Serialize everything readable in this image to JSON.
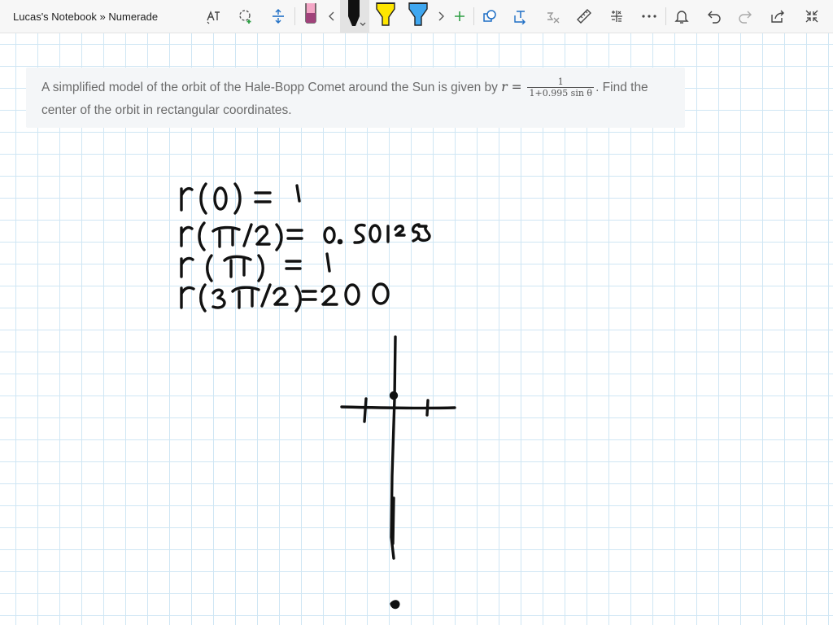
{
  "app": {
    "title": "Lucas's Notebook » Numerade"
  },
  "toolbar": {
    "icons": [
      "lasso-text-icon",
      "lasso-select-icon",
      "insert-space-icon",
      "pen-icon",
      "chevron-left-icon",
      "marker-icon",
      "highlighter-yellow-icon",
      "highlighter-blue-icon",
      "chevron-right-icon",
      "add-pen-icon",
      "ink-to-shape-icon",
      "ink-to-text-icon",
      "ink-to-math-icon",
      "ruler-icon",
      "math-icon",
      "more-icon",
      "bell-icon",
      "undo-icon",
      "redo-icon",
      "share-icon",
      "collapse-icon"
    ],
    "colors": {
      "pen_pink": "#f4a6c6",
      "highlighter_yellow": "#ffe600",
      "highlighter_blue": "#3fa7f0",
      "accent_green": "#2e9e44",
      "accent_blue": "#1f6fc5"
    }
  },
  "question": {
    "text_before": "A simplified model of the orbit of the Hale-Bopp Comet around the Sun is given by ",
    "var": "r",
    "eq": " = ",
    "frac_num": "1",
    "frac_den": "1+0.995 sin θ",
    "text_after": ". Find the center of the orbit in rectangular coordinates."
  },
  "handwriting": {
    "lines": [
      "r(0) = 1",
      "r(π/2) = 0.501253",
      "r(π) = 1",
      "r(3π/2) = 200"
    ]
  }
}
